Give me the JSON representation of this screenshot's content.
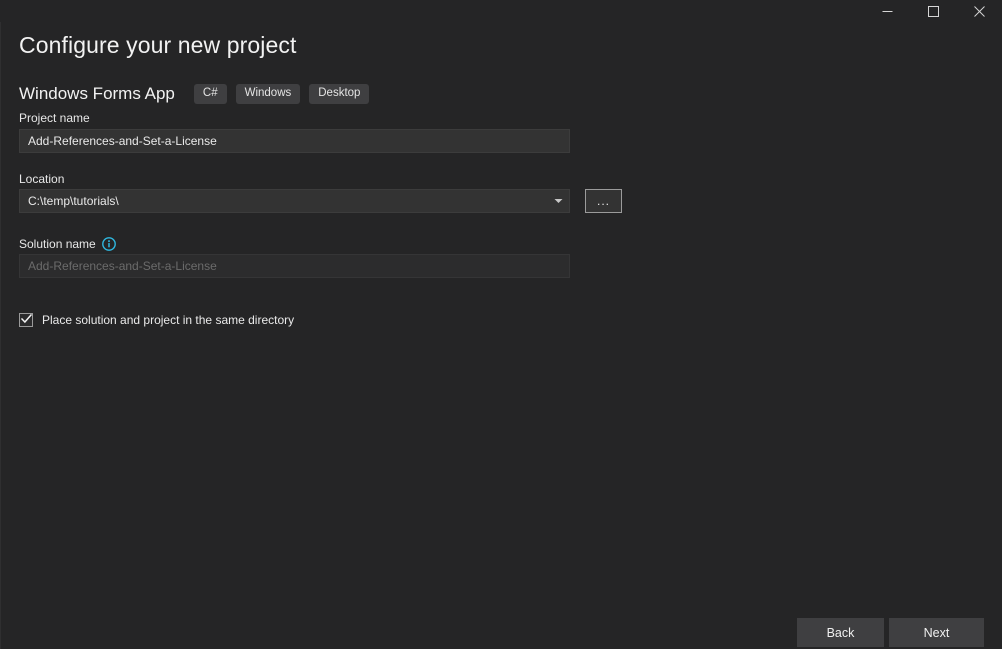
{
  "window": {
    "controls": [
      {
        "name": "minimize",
        "label": "Minimize"
      },
      {
        "name": "maximize",
        "label": "Maximize"
      },
      {
        "name": "close",
        "label": "Close"
      }
    ]
  },
  "header": {
    "title": "Configure your new project",
    "template_name": "Windows Forms App",
    "tags": [
      "C#",
      "Windows",
      "Desktop"
    ]
  },
  "form": {
    "project_name": {
      "label": "Project name",
      "value": "Add-References-and-Set-a-License"
    },
    "location": {
      "label": "Location",
      "value": "C:\\temp\\tutorials\\",
      "browse_label": "...",
      "caret_icon": "chevron-down-icon"
    },
    "solution_name": {
      "label": "Solution name",
      "info_icon": "info-icon",
      "value": "Add-References-and-Set-a-License",
      "disabled": true
    },
    "same_directory": {
      "label": "Place solution and project in the same directory",
      "checked": true
    }
  },
  "footer": {
    "back_label": "Back",
    "next_label": "Next"
  },
  "colors": {
    "background": "#252526",
    "input_background": "#333333",
    "input_disabled_background": "#2c2c2d",
    "tag_background": "#3f3f41",
    "button_background": "#3f3f41",
    "text_primary": "#f0f0f0",
    "text_disabled": "#6b6b6b",
    "accent_info": "#2fb8e0"
  }
}
